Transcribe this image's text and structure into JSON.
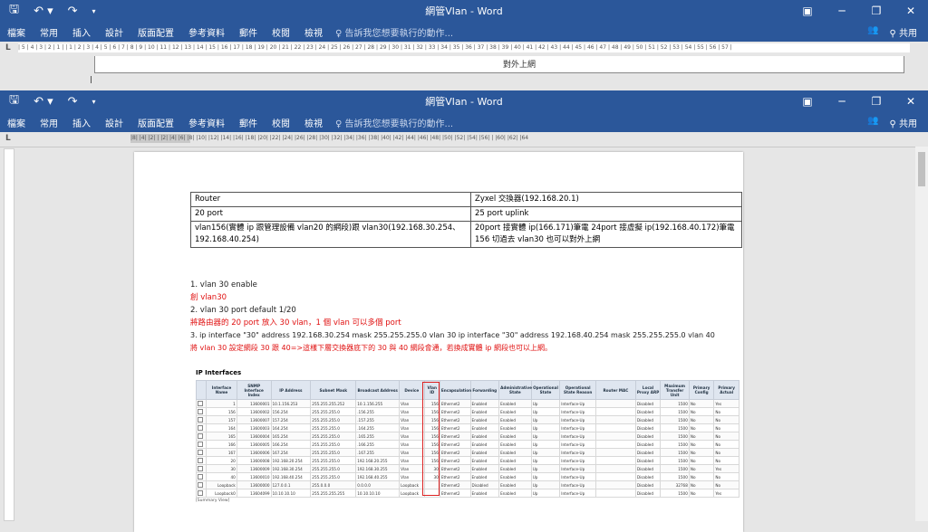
{
  "window_top": {
    "title": "網管Vlan - Word",
    "menu": [
      "檔案",
      "常用",
      "插入",
      "設計",
      "版面配置",
      "參考資料",
      "郵件",
      "校閱",
      "檢視"
    ],
    "tell_me": "告訴我您想要執行的動作...",
    "share": "共用",
    "ruler_text": "| 5 | 4 | 3 | 2 | 1 | | 1 | 2 | 3 | 4 | 5 | 6 | 7 | 8 | 9 | 10 | 11 | 12 | 13 | 14 | 15 | 16 | 17 | 18 | 19 | 20 | 21 | 22 | 23 | 24 | 25 | 26 | 27 | 28 | 29 | 30 | 31 | 32 | 33 | 34 | 35 | 36 | 37 | 38 | 39 | 40 | 41 | 42 | 43 | 44 | 45 | 46 | 47 | 48 | 49 | 50 | 51 | 52 | 53 | 54 | 55 | 56 | 57 |",
    "peek_text": "對外上網"
  },
  "window_main": {
    "title": "網管Vlan - Word",
    "menu": [
      "檔案",
      "常用",
      "插入",
      "設計",
      "版面配置",
      "參考資料",
      "郵件",
      "校閱",
      "檢視"
    ],
    "tell_me": "告訴我您想要執行的動作...",
    "share": "共用",
    "ruler_text": "|8| |4| |2| |  |2| |4| |6| |8| |10| |12| |14| |16| |18| |20| |22| |24| |26| |28| |30| |32| |34| |36| |38| |40| |42| |44| |46| |48| |50| |52| |54| |56| |  |60| |62| |64"
  },
  "doc_table": [
    [
      "Router",
      "Zyxel 交換器(192.168.20.1)"
    ],
    [
      "20 port",
      "25 port uplink"
    ],
    [
      "vlan156(實體 ip 跟管理設備 vlan20 的網段)跟 vlan30(192.168.30.254、192.168.40.254)",
      "20port 接實體 ip(166.171)筆電 24port 接虛擬 ip(192.168.40.172)筆電 156 切過去 vlan30 也可以對外上網"
    ]
  ],
  "paragraphs": {
    "p1": "1.   vlan 30 enable",
    "p1_note": "創 vlan30",
    "p2": "2.   vlan 30 port default 1/20",
    "p2_note": "將路由器的 20 port 放入 30 vlan，1 個 vlan 可以多個 port",
    "p3": "3. ip interface \"30\" address 192.168.30.254 mask 255.255.255.0 vlan 30 ip interface \"30\" address 192.168.40.254 mask 255.255.255.0 vlan 40",
    "p3_note": "將 vlan 30  設定網段 30 跟 40=>這樣下層交換器底下的 30 與 40 網段會通，若換成實體 ip 網段也可以上網。"
  },
  "screenshot": {
    "heading": "IP Interfaces",
    "columns": [
      "",
      "Interface Name",
      "SNMP Interface Index",
      "IP Address",
      "Subnet Mask",
      "Broadcast Address",
      "Device",
      "Vlan ID",
      "Encapsulation",
      "Forwarding",
      "Administrative State",
      "Operational State",
      "Operational State Reason",
      "Router MAC",
      "Local Proxy ARP",
      "Maximum Transfer Unit",
      "Primary Config",
      "Primary Actual"
    ],
    "rows": [
      [
        "",
        "1",
        "13600001",
        "10.1.156.253",
        "255.255.255.252",
        "10.1.156.255",
        "Vlan",
        "156",
        "Ethernet2",
        "Enabled",
        "Enabled",
        "Up",
        "Interface-Up",
        "",
        "Disabled",
        "1500",
        "No",
        "Yes"
      ],
      [
        "",
        "156",
        "13600002",
        "156.254",
        "255.255.255.0",
        ".156.255",
        "Vlan",
        "156",
        "Ethernet2",
        "Enabled",
        "Enabled",
        "Up",
        "Interface-Up",
        "",
        "Disabled",
        "1500",
        "No",
        "No"
      ],
      [
        "",
        "157",
        "13600007",
        "157.254",
        "255.255.255.0",
        ".157.255",
        "Vlan",
        "156",
        "Ethernet2",
        "Enabled",
        "Enabled",
        "Up",
        "Interface-Up",
        "",
        "Disabled",
        "1500",
        "No",
        "No"
      ],
      [
        "",
        "164",
        "13600003",
        "164.254",
        "255.255.255.0",
        ".164.255",
        "Vlan",
        "156",
        "Ethernet2",
        "Enabled",
        "Enabled",
        "Up",
        "Interface-Up",
        "",
        "Disabled",
        "1500",
        "No",
        "No"
      ],
      [
        "",
        "165",
        "13600004",
        "165.254",
        "255.255.255.0",
        ".165.255",
        "Vlan",
        "156",
        "Ethernet2",
        "Enabled",
        "Enabled",
        "Up",
        "Interface-Up",
        "",
        "Disabled",
        "1500",
        "No",
        "No"
      ],
      [
        "",
        "166",
        "13600005",
        "166.254",
        "255.255.255.0",
        ".166.255",
        "Vlan",
        "156",
        "Ethernet2",
        "Enabled",
        "Enabled",
        "Up",
        "Interface-Up",
        "",
        "Disabled",
        "1500",
        "No",
        "No"
      ],
      [
        "",
        "167",
        "13600006",
        "167.254",
        "255.255.255.0",
        ".167.255",
        "Vlan",
        "156",
        "Ethernet2",
        "Enabled",
        "Enabled",
        "Up",
        "Interface-Up",
        "",
        "Disabled",
        "1500",
        "No",
        "No"
      ],
      [
        "",
        "20",
        "13600008",
        "192.168.20.254",
        "255.255.255.0",
        "192.168.20.255",
        "Vlan",
        "156",
        "Ethernet2",
        "Enabled",
        "Enabled",
        "Up",
        "Interface-Up",
        "",
        "Disabled",
        "1500",
        "No",
        "No"
      ],
      [
        "",
        "30",
        "13600009",
        "192.168.30.254",
        "255.255.255.0",
        "192.168.30.255",
        "Vlan",
        "30",
        "Ethernet2",
        "Enabled",
        "Enabled",
        "Up",
        "Interface-Up",
        "",
        "Disabled",
        "1500",
        "No",
        "Yes"
      ],
      [
        "",
        "40",
        "13600010",
        "192.168.40.254",
        "255.255.255.0",
        "192.168.40.255",
        "Vlan",
        "30",
        "Ethernet2",
        "Enabled",
        "Enabled",
        "Up",
        "Interface-Up",
        "",
        "Disabled",
        "1500",
        "No",
        "No"
      ],
      [
        "",
        "Loopback",
        "13600000",
        "127.0.0.1",
        "255.0.0.0",
        "0.0.0.0",
        "Loopback",
        "",
        "Ethernet2",
        "Disabled",
        "Enabled",
        "Up",
        "Interface-Up",
        "",
        "Disabled",
        "32768",
        "No",
        "No"
      ],
      [
        "",
        "Loopback0",
        "13604099",
        "10.10.10.10",
        "255.255.255.255",
        "10.10.10.10",
        "Loopback",
        "",
        "Ethernet2",
        "Enabled",
        "Enabled",
        "Up",
        "Interface-Up",
        "",
        "Disabled",
        "1500",
        "No",
        "Yes"
      ]
    ],
    "footer": "[Summary View]"
  }
}
